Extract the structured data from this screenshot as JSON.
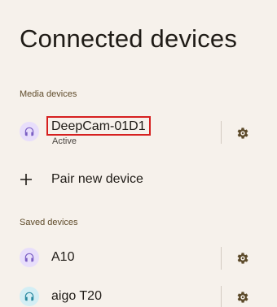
{
  "page": {
    "title": "Connected devices"
  },
  "media_devices": {
    "header": "Media devices",
    "items": [
      {
        "name": "DeepCam-01D1",
        "status": "Active",
        "icon": "headphones-icon",
        "icon_bg": "#e8defb",
        "icon_fg": "#7b5fc4",
        "highlighted": true
      }
    ]
  },
  "pair": {
    "label": "Pair new device",
    "icon": "plus-icon"
  },
  "saved_devices": {
    "header": "Saved devices",
    "items": [
      {
        "name": "A10",
        "icon": "headphones-icon",
        "icon_bg": "#e8defb",
        "icon_fg": "#7b5fc4"
      },
      {
        "name": "aigo T20",
        "icon": "headphones-icon",
        "icon_bg": "#d3eef4",
        "icon_fg": "#2c8aa0"
      }
    ]
  },
  "colors": {
    "background": "#f6f1eb",
    "section_header": "#5f4b2a",
    "highlight_box": "#d6201f",
    "gear": "#5c4a2a"
  }
}
